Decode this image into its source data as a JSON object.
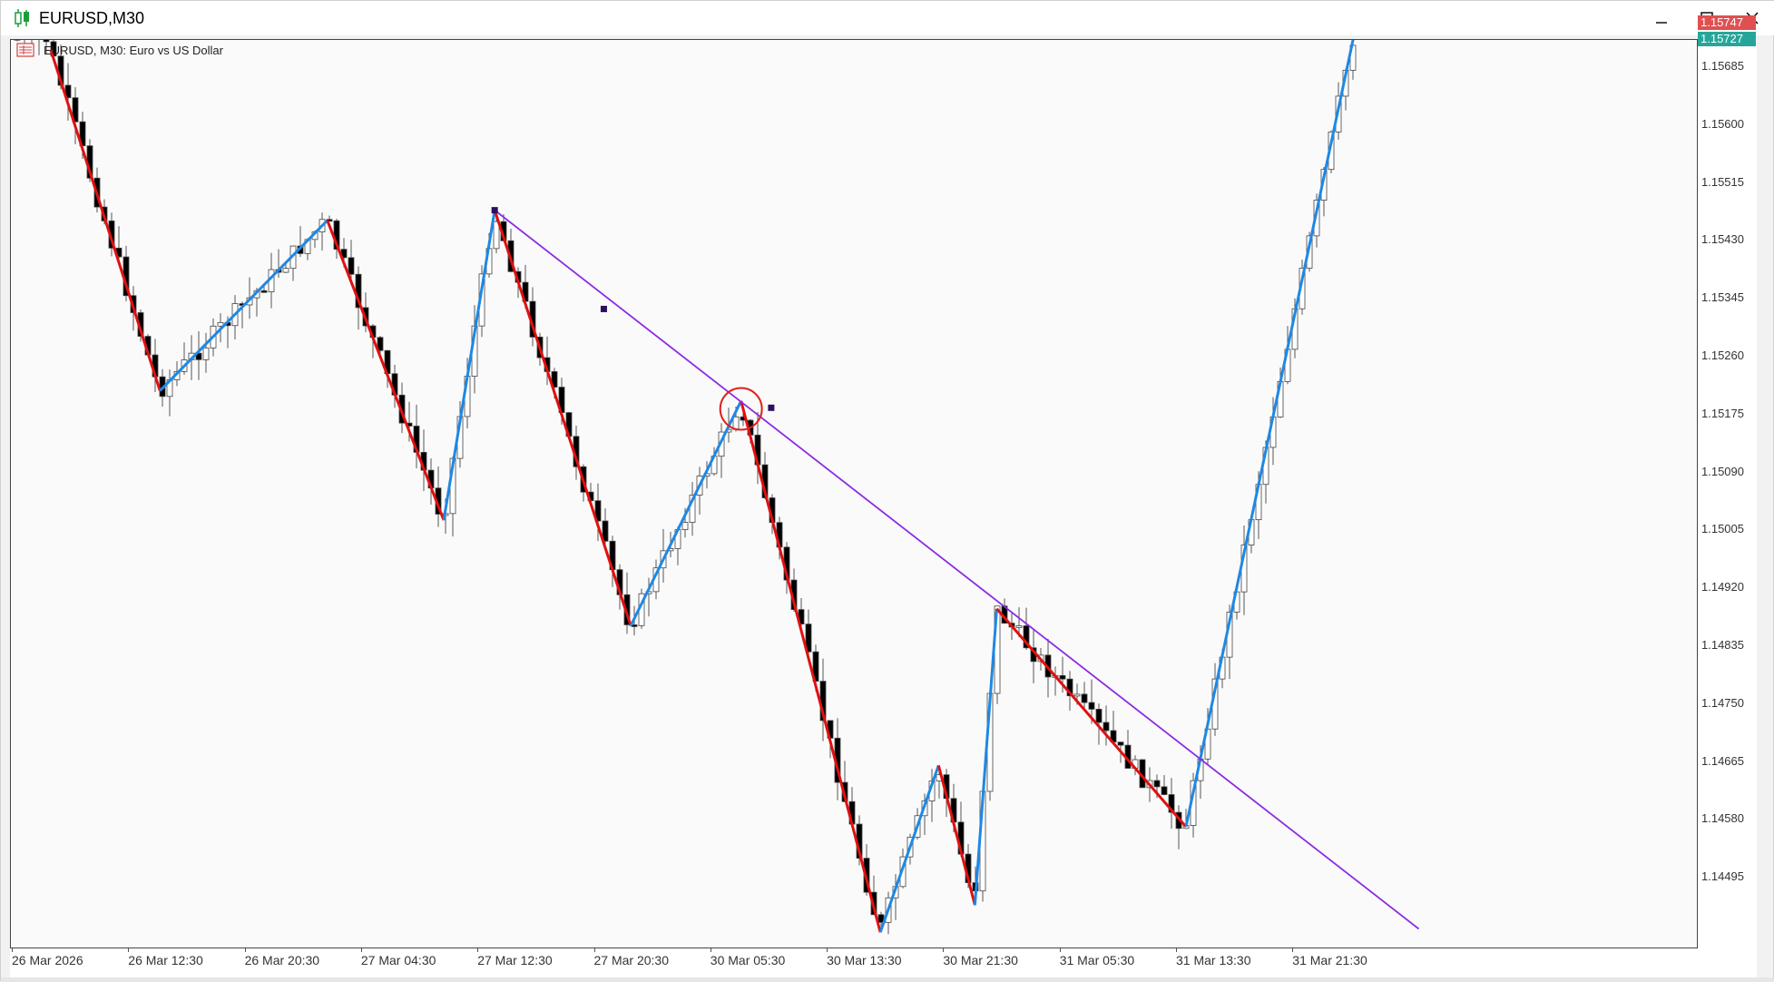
{
  "window": {
    "title": "EURUSD,M30",
    "controls": [
      "minimize-button",
      "maximize-button",
      "close-button"
    ]
  },
  "chart": {
    "header_text": "EURUSD, M30:  Euro vs US Dollar",
    "symbol": "EURUSD",
    "timeframe": "M30",
    "colors": {
      "bull_body": "#ffffff",
      "bear_body": "#000000",
      "zigzag_up": "#1e88e5",
      "zigzag_down": "#e01010",
      "trendline": "#8a2be2",
      "ask_line": "#e05050",
      "bid_line": "#26a69a"
    }
  },
  "price_scale": {
    "labels": [
      "1.15685",
      "1.15600",
      "1.15515",
      "1.15430",
      "1.15345",
      "1.15260",
      "1.15175",
      "1.15090",
      "1.15005",
      "1.14920",
      "1.14835",
      "1.14750",
      "1.14665",
      "1.14580",
      "1.14495"
    ],
    "ask_tag": "1.15747",
    "bid_tag": "1.15727"
  },
  "time_scale": {
    "labels": [
      "26 Mar 2026",
      "26 Mar 12:30",
      "26 Mar 20:30",
      "27 Mar 04:30",
      "27 Mar 12:30",
      "27 Mar 20:30",
      "30 Mar 05:30",
      "30 Mar 13:30",
      "30 Mar 21:30",
      "31 Mar 05:30",
      "31 Mar 13:30",
      "31 Mar 21:30"
    ]
  },
  "zigzag_pivots": [
    {
      "time": "26 Mar 05:00",
      "price": 1.1571
    },
    {
      "time": "26 Mar 12:30",
      "price": 1.1521
    },
    {
      "time": "27 Mar 00:00",
      "price": 1.1546
    },
    {
      "time": "27 Mar 08:00",
      "price": 1.1502
    },
    {
      "time": "27 Mar 11:30",
      "price": 1.15475
    },
    {
      "time": "27 Mar 23:00",
      "price": 1.14865
    },
    {
      "time": "30 Mar 05:00",
      "price": 1.15195
    },
    {
      "time": "30 Mar 15:00",
      "price": 1.14415
    },
    {
      "time": "30 Mar 19:00",
      "price": 1.1466
    },
    {
      "time": "30 Mar 21:30",
      "price": 1.14455
    },
    {
      "time": "30 Mar 23:00",
      "price": 1.1489
    },
    {
      "time": "31 Mar 12:00",
      "price": 1.1457
    },
    {
      "time": "31 Mar 23:30",
      "price": 1.15727
    }
  ],
  "trendline": {
    "start": {
      "time": "27 Mar 11:30",
      "price": 1.15475
    },
    "end": {
      "time": "01 Apr 04:00",
      "price": 1.1442
    },
    "anchors": [
      {
        "time": "27 Mar 11:30",
        "price": 1.15475
      },
      {
        "time": "27 Mar 19:00",
        "price": 1.1533
      },
      {
        "time": "30 Mar 07:30",
        "price": 1.15185
      }
    ]
  },
  "marker_circle": {
    "time": "30 Mar 05:00",
    "price": 1.1519
  }
}
